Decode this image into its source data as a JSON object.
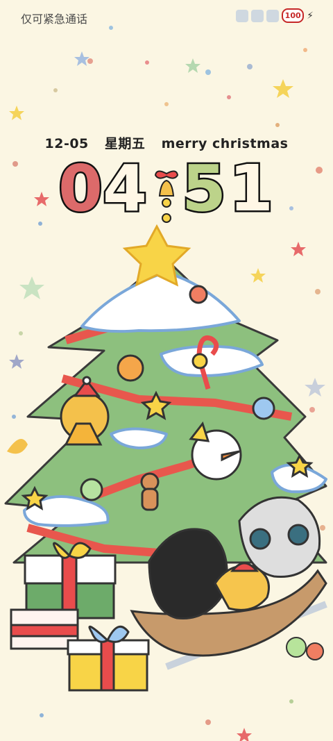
{
  "status_bar": {
    "carrier_text": "仅可紧急通话",
    "battery_level": "100",
    "icons": [
      "notification-icon",
      "notification-icon",
      "notification-icon",
      "battery-icon",
      "charging-icon"
    ]
  },
  "lockscreen": {
    "date": "12-05",
    "weekday": "星期五",
    "greeting": "merry christmas",
    "clock": {
      "d1": "0",
      "d2": "4",
      "d3": "5",
      "d4": "1"
    },
    "colors": {
      "d1": "#dc6a6a",
      "d2": "#fff7e6",
      "d3": "#bcd38a",
      "d4": "#fff7e6"
    }
  }
}
